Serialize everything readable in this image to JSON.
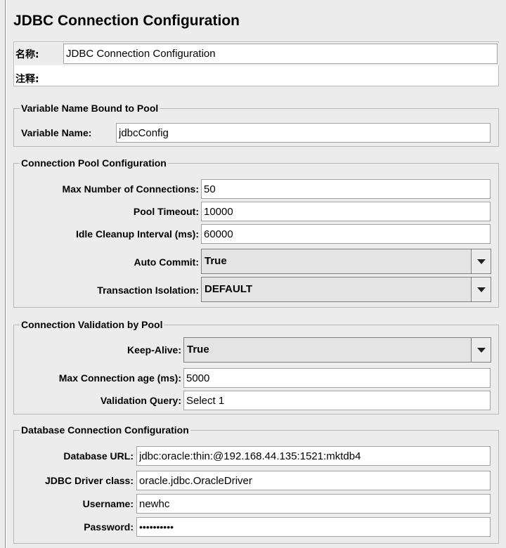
{
  "title": "JDBC Connection Configuration",
  "name_label": "名称:",
  "name_value": "JDBC Connection Configuration",
  "comments_label": "注释:",
  "comments_value": "",
  "var_group": {
    "legend": "Variable Name Bound to Pool",
    "variable_name_label": "Variable Name:",
    "variable_name_value": "jdbcConfig"
  },
  "pool_group": {
    "legend": "Connection Pool Configuration",
    "max_connections_label": "Max Number of Connections:",
    "max_connections_value": "50",
    "pool_timeout_label": "Pool Timeout:",
    "pool_timeout_value": "10000",
    "idle_cleanup_label": "Idle Cleanup Interval (ms):",
    "idle_cleanup_value": "60000",
    "auto_commit_label": "Auto Commit:",
    "auto_commit_value": "True",
    "transaction_isolation_label": "Transaction Isolation:",
    "transaction_isolation_value": "DEFAULT"
  },
  "validation_group": {
    "legend": "Connection Validation by Pool",
    "keep_alive_label": "Keep-Alive:",
    "keep_alive_value": "True",
    "max_age_label": "Max Connection age (ms):",
    "max_age_value": "5000",
    "validation_query_label": "Validation Query:",
    "validation_query_value": "Select 1"
  },
  "db_group": {
    "legend": "Database Connection Configuration",
    "url_label": "Database URL:",
    "url_value": "jdbc:oracle:thin:@192.168.44.135:1521:mktdb4",
    "driver_label": "JDBC Driver class:",
    "driver_value": "oracle.jdbc.OracleDriver",
    "username_label": "Username:",
    "username_value": "newhc",
    "password_label": "Password:",
    "password_value": "••••••••••"
  },
  "icons": {
    "dropdown": "chevron-down-icon"
  }
}
